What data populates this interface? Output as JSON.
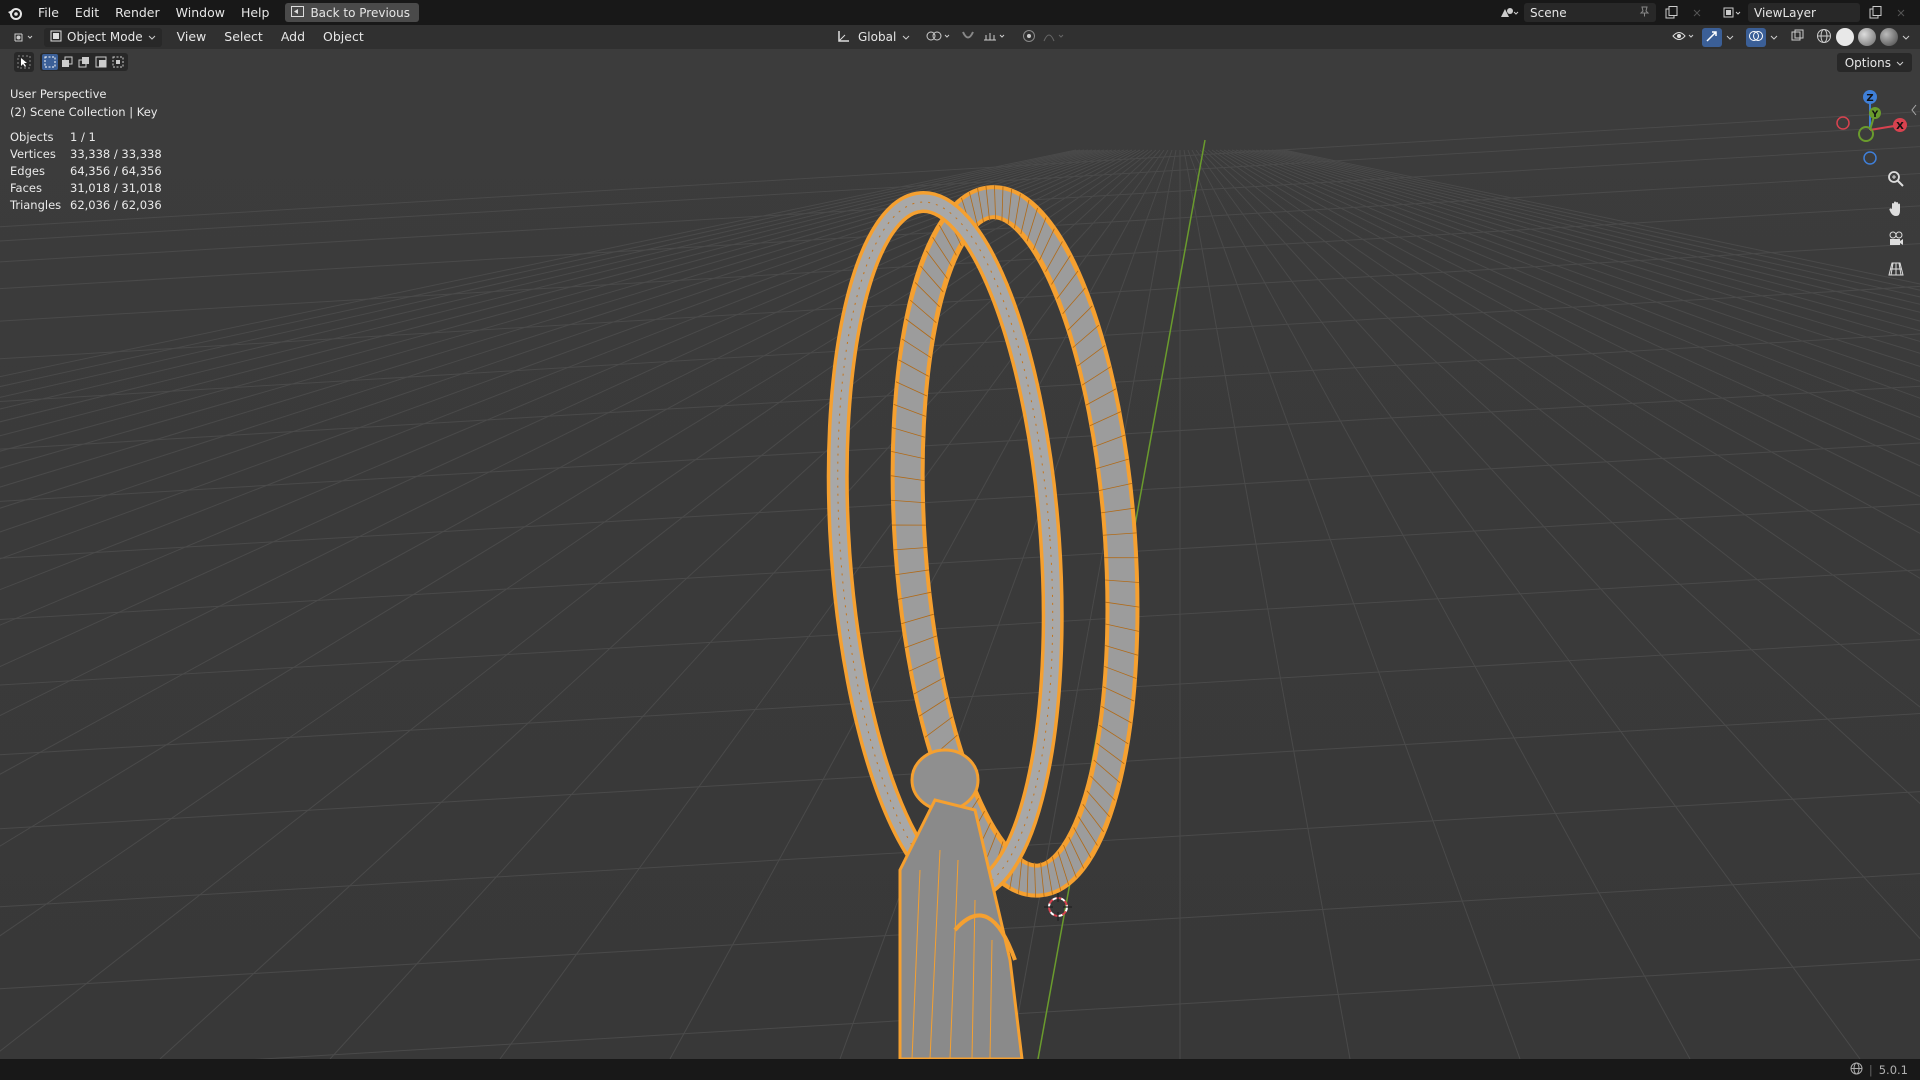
{
  "topbar": {
    "menus": [
      "File",
      "Edit",
      "Render",
      "Window",
      "Help"
    ],
    "back_button": "Back to Previous",
    "scene": "Scene",
    "view_layer": "ViewLayer"
  },
  "header": {
    "mode": "Object Mode",
    "menus": [
      "View",
      "Select",
      "Add",
      "Object"
    ],
    "transform_orientation": "Global"
  },
  "options_label": "Options",
  "viewport": {
    "perspective": "User Perspective",
    "collection": "(2) Scene Collection | Key",
    "stats": [
      {
        "label": "Objects",
        "value": "1 / 1"
      },
      {
        "label": "Vertices",
        "value": "33,338 / 33,338"
      },
      {
        "label": "Edges",
        "value": "64,356 / 64,356"
      },
      {
        "label": "Faces",
        "value": "31,018 / 31,018"
      },
      {
        "label": "Triangles",
        "value": "62,036 / 62,036"
      }
    ]
  },
  "gizmo": {
    "x": "X",
    "y": "Y",
    "z": "Z"
  },
  "status": {
    "version": "5.0.1"
  },
  "colors": {
    "selection": "#f5a030",
    "axis_y": "#6a9b2d",
    "axis_x": "#d8424f",
    "axis_z": "#3f7fd8"
  }
}
